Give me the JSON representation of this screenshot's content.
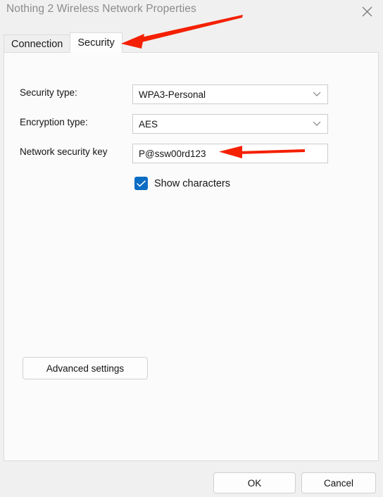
{
  "window": {
    "title": "Nothing 2 Wireless Network Properties",
    "close_icon": "close-icon"
  },
  "tabs": [
    {
      "label": "Connection",
      "selected": false
    },
    {
      "label": "Security",
      "selected": true
    }
  ],
  "security_tab": {
    "fields": [
      {
        "label": "Security type:",
        "control": "dropdown",
        "value": "WPA3-Personal",
        "chevron_icon": "chevron-down-icon"
      },
      {
        "label": "Encryption type:",
        "control": "dropdown",
        "value": "AES",
        "chevron_icon": "chevron-down-icon"
      },
      {
        "label": "Network security key",
        "control": "textbox",
        "value": "P@ssw00rd123"
      }
    ],
    "show_characters": {
      "label": "Show characters",
      "checked": true,
      "check_icon": "checkmark-icon"
    },
    "advanced_settings_label": "Advanced settings"
  },
  "footer": {
    "ok_label": "OK",
    "cancel_label": "Cancel"
  },
  "annotations": [
    {
      "name": "arrow-to-security-tab"
    },
    {
      "name": "arrow-to-network-security-key"
    }
  ],
  "colors": {
    "dialog_background": "#f0f0f0",
    "panel_background": "#fbfbfb",
    "title_text": "#8b8b8b",
    "checkbox_accent": "#0b6cc4",
    "annotation_red": "#f42000"
  }
}
